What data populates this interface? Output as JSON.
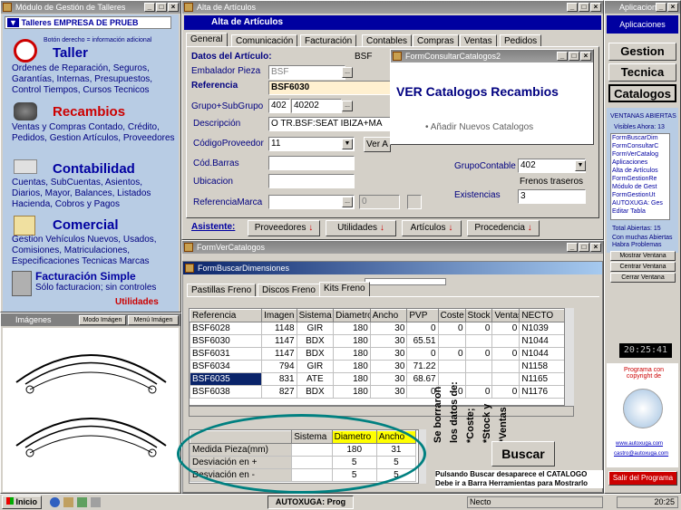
{
  "left_window": {
    "title": "Módulo de Gestión de Talleres",
    "dropdown": "Talleres EMPRESA DE PRUEB",
    "hint": "Botón derecho = información adicional",
    "taller": {
      "title": "Taller",
      "text": "Ordenes de Reparación, Seguros, Garantías, Internas, Presupuestos, Control Tiempos, Cursos Tecnicos"
    },
    "recambios": {
      "title": "Recambios",
      "text": "Ventas y Compras Contado, Crédito, Pedidos, Gestion Artículos, Proveedores"
    },
    "contabilidad": {
      "title": "Contabilidad",
      "text": "Cuentas, SubCuentas, Asientos, Diarios, Mayor, Balances, Listados Hacienda, Cobros y Pagos"
    },
    "comercial": {
      "title": "Comercial",
      "text": "Gestion Vehículos Nuevos, Usados, Comisiones, Matriculaciones, Especificaciones Tecnicas Marcas"
    },
    "facturacion": {
      "title": "Facturación Simple",
      "text": "Sólo facturacion; sin controles"
    },
    "utilidades": "Utilidades"
  },
  "images_panel": {
    "title": "Imágenes",
    "btn_modo": "Modo Imágen",
    "btn_menu": "Menú Imágen"
  },
  "alta": {
    "title": "Alta de Artículos",
    "header": "Alta de Artículos",
    "tabs": [
      "General",
      "Comunicación",
      "Facturación",
      "Contables",
      "Compras",
      "Ventas",
      "Pedidos"
    ],
    "labels": {
      "datos": "Datos del Artículo:",
      "embalador": "Embalador Pieza",
      "referencia": "Referencia",
      "grupo": "Grupo+SubGrupo",
      "descripcion": "Descripción",
      "codprov": "CódigoProveedor",
      "codbarras": "Cód.Barras",
      "ubicacion": "Ubicacion",
      "refmarca": "ReferenciaMarca",
      "grupocontable": "GrupoContable",
      "existencias": "Existencias",
      "asistente": "Asistente:"
    },
    "values": {
      "datos": "BSF",
      "embalador": "BSF",
      "referencia": "BSF6030",
      "grupo": "402",
      "subgrupo": "40202",
      "descripcion": "O TR.BSF:SEAT IBIZA+MA",
      "codprov": "11",
      "ver": "Ver A",
      "refmarca_num": "0",
      "grupocontable": "402",
      "frenos": "Frenos traseros",
      "existencias": "3"
    },
    "bottom_buttons": [
      "Proveedores",
      "Utilidades",
      "Artículos",
      "Procedencia"
    ]
  },
  "consultar": {
    "title": "FormConsultarCatalogos2",
    "heading": "VER Catalogos Recambios",
    "item": "Añadir Nuevos Catalogos"
  },
  "ver_catalogos": {
    "title": "FormVerCatalogos"
  },
  "buscar": {
    "title": "FormBuscarDimensiones",
    "tabs": [
      "Pastillas Freno",
      "Discos Freno",
      "Kits Freno"
    ],
    "columns": [
      "Referencia",
      "Imagen",
      "Sistema",
      "Diametro",
      "Ancho",
      "PVP",
      "Coste",
      "Stock",
      "Ventas",
      "NECTO"
    ],
    "rows": [
      [
        "BSF6028",
        "1148",
        "GIR",
        "180",
        "30",
        "0",
        "0",
        "0",
        "0",
        "N1039"
      ],
      [
        "BSF6030",
        "1147",
        "BDX",
        "180",
        "30",
        "65.51",
        "",
        "",
        "",
        "N1044"
      ],
      [
        "BSF6031",
        "1147",
        "BDX",
        "180",
        "30",
        "0",
        "0",
        "0",
        "0",
        "N1044"
      ],
      [
        "BSF6034",
        "794",
        "GIR",
        "180",
        "30",
        "71.22",
        "",
        "",
        "",
        "N1158"
      ],
      [
        "BSF6035",
        "831",
        "ATE",
        "180",
        "30",
        "68.67",
        "",
        "",
        "",
        "N1165"
      ],
      [
        "BSF6038",
        "827",
        "BDX",
        "180",
        "30",
        "0",
        "0",
        "0",
        "0",
        "N1176"
      ]
    ],
    "note_rot": [
      "Se borraron",
      "los datos de:",
      "*Coste;",
      "*Stock y",
      "*Ventas"
    ],
    "dim_columns": [
      "",
      "Sistema",
      "Diametro",
      "Ancho"
    ],
    "dim_rows": [
      [
        "Medida Pieza(mm)",
        "",
        "180",
        "31"
      ],
      [
        "Desviación en +",
        "",
        "5",
        "5"
      ],
      [
        "Desviación en -",
        "",
        "5",
        "5"
      ]
    ],
    "buscar_btn": "Buscar",
    "note": "Pulsando Buscar desaparece el CATALOGO Debe ir a Barra Herramientas para Mostrarlo"
  },
  "right": {
    "title": "Aplicaciones",
    "header": "Aplicaciones",
    "gestion": "Gestion",
    "tecnica": "Tecnica",
    "catalogos": "Catalogos",
    "ventanas_title": "VENTANAS ABIERTAS",
    "visibles": "Visibles Ahora: 13",
    "list": [
      "FormBuscarDim",
      "FormConsultarC",
      "FormVerCatalog",
      "Aplicaciones",
      "Alta de Artículos",
      "FormGestionRe",
      "Módulo de Gest",
      "FormGestionUt",
      "AUTOXUGA: Ges",
      "Editar Tabla"
    ],
    "total": "Total Abiertas: 15",
    "muchas": "Con muchas Abiertas Habra Problemas",
    "btns": [
      "Mostrar Ventana",
      "Centrar Ventana",
      "Cerrar Ventana"
    ],
    "clock": "20:25:41",
    "copyright": "Programa con copyright de",
    "link1": "www.autoxuga.com",
    "link2": "castro@autoxuga.com",
    "salir": "Salir del Programa"
  },
  "taskbar": {
    "start": "Inicio",
    "task": "AUTOXUGA: Prog",
    "status": "Necto",
    "time": "20:25"
  },
  "colors": {
    "accent": "#0000a0",
    "red": "#cc0000",
    "highlight": "#ffff00",
    "teal": "#008080"
  }
}
